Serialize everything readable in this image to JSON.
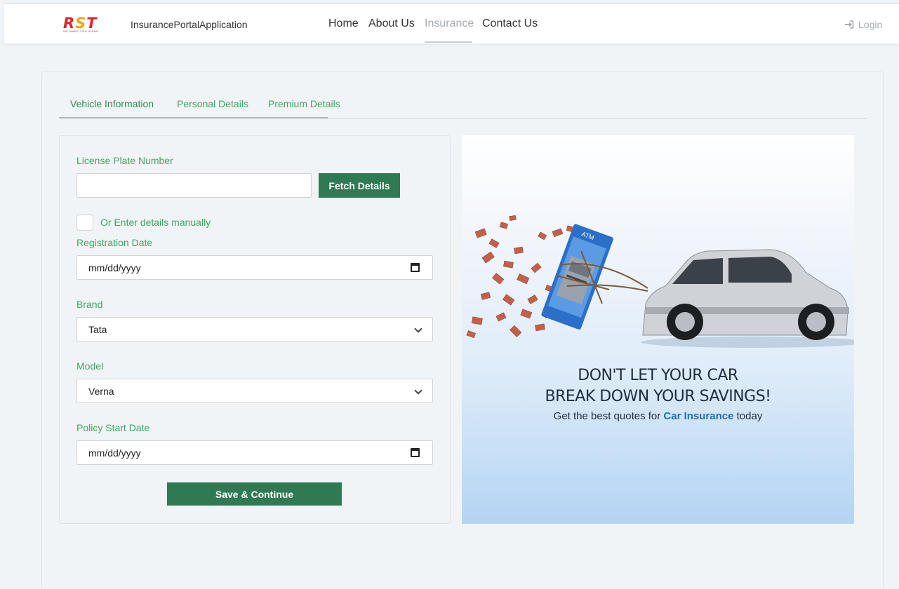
{
  "navbar": {
    "logo_text": "RST",
    "logo_tagline": "WE MAKE YOU SHINE",
    "brand": "InsurancePortalApplication",
    "links": [
      {
        "label": "Home"
      },
      {
        "label": "About Us"
      },
      {
        "label": "Insurance"
      },
      {
        "label": "Contact Us"
      }
    ],
    "active_link": "Insurance",
    "login_label": "Login",
    "login_icon": "sign-in-icon"
  },
  "tabs": [
    {
      "label": "Vehicle Information"
    },
    {
      "label": "Personal Details"
    },
    {
      "label": "Premium Details"
    }
  ],
  "active_tab": "Vehicle Information",
  "form": {
    "license_label": "License Plate Number",
    "license_value": "",
    "fetch_button": "Fetch Details",
    "manual_label": "Or Enter details manually",
    "manual_checked": false,
    "registration_label": "Registration Date",
    "registration_value": "mm/dd/yyyy",
    "brand_label": "Brand",
    "brand_value": "Tata",
    "model_label": "Model",
    "model_value": "Verna",
    "policy_label": "Policy Start Date",
    "policy_value": "mm/dd/yyyy",
    "save_button": "Save & Continue"
  },
  "banner": {
    "headline_1": "DON'T LET YOUR CAR",
    "headline_2": "BREAK DOWN YOUR SAVINGS!",
    "sub_prefix": "Get the best quotes for",
    "sub_highlight": "Car Insurance",
    "sub_suffix": "today",
    "atm_text": "ATM"
  },
  "colors": {
    "accent_green": "#3ea55f",
    "button_green": "#2f7a52",
    "highlight_blue": "#1f6fb3"
  }
}
